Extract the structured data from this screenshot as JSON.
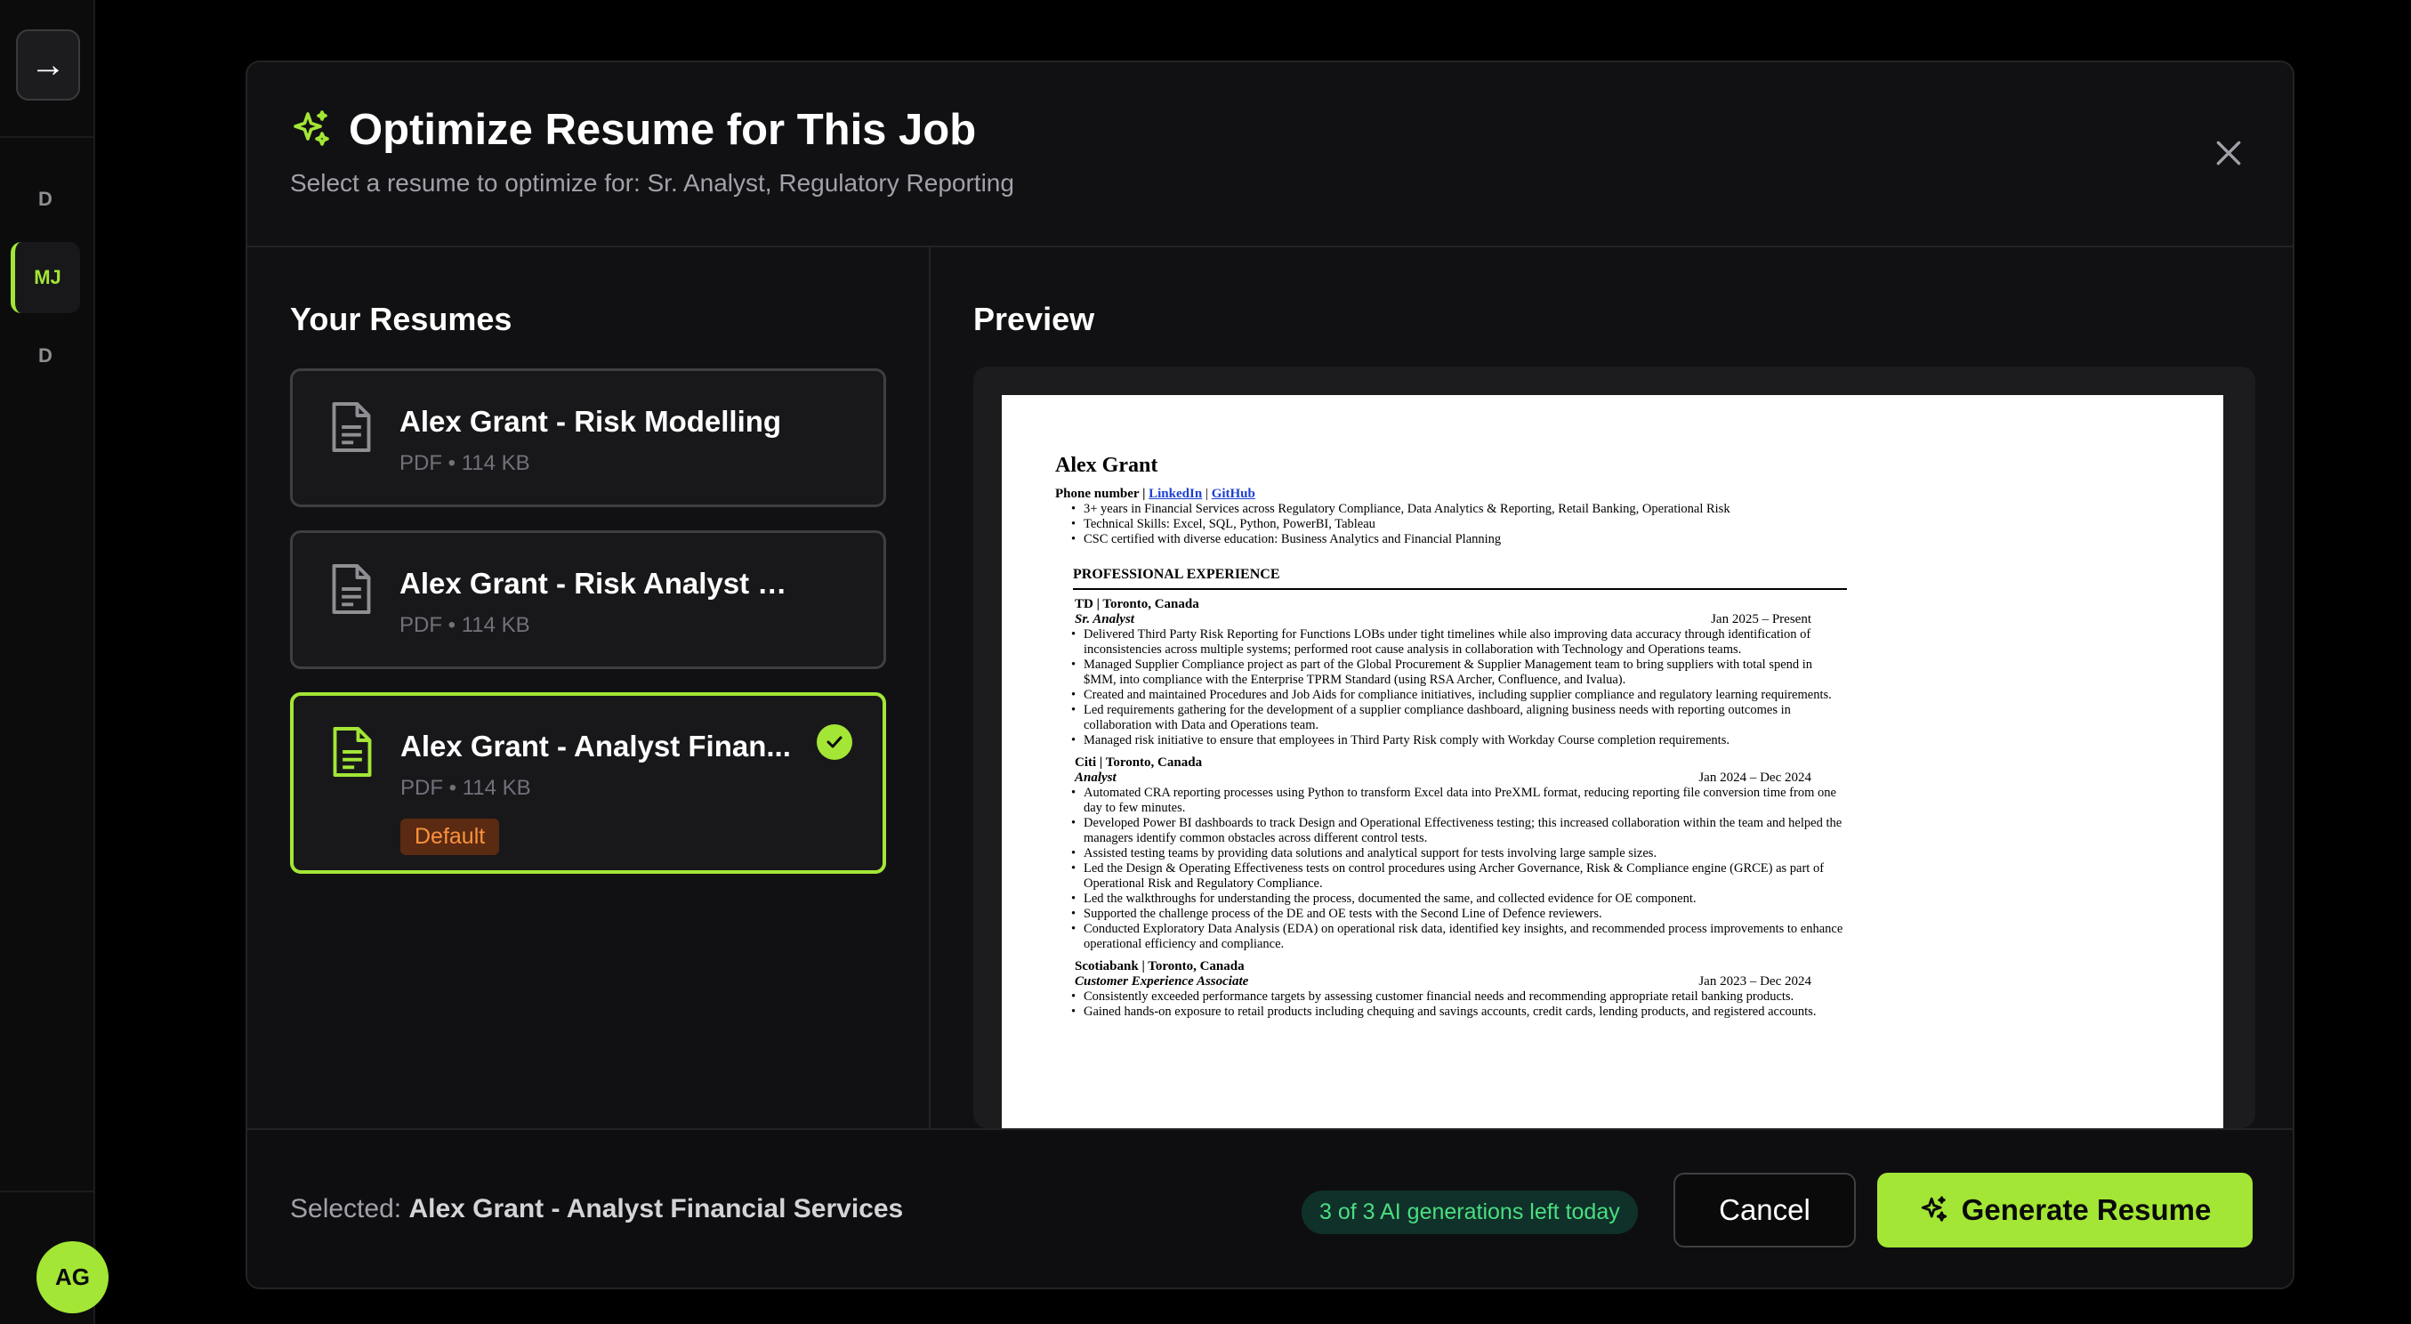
{
  "sidebar": {
    "toggle_icon": "→",
    "items": [
      {
        "label": "D"
      },
      {
        "label": "MJ"
      },
      {
        "label": "D"
      }
    ],
    "avatar": "AG"
  },
  "modal": {
    "title": "Optimize Resume for This Job",
    "subtitle": "Select a resume to optimize for: Sr. Analyst, Regulatory Reporting",
    "left_heading": "Your Resumes",
    "right_heading": "Preview",
    "resumes": [
      {
        "name": "Alex Grant - Risk Modelling",
        "meta": "PDF • 114 KB"
      },
      {
        "name": "Alex Grant - Risk Analyst Insur...",
        "meta": "PDF • 114 KB"
      },
      {
        "name": "Alex Grant - Analyst Finan...",
        "meta": "PDF • 114 KB",
        "badge": "Default"
      }
    ]
  },
  "preview": {
    "name": "Alex Grant",
    "contact_label": "Phone number |",
    "linkedin": "LinkedIn",
    "github": "GitHub",
    "summary": [
      "3+ years in Financial Services across Regulatory Compliance, Data Analytics & Reporting, Retail Banking, Operational Risk",
      "Technical Skills: Excel, SQL, Python, PowerBI, Tableau",
      "CSC certified with diverse education: Business Analytics and Financial Planning"
    ],
    "section": "PROFESSIONAL EXPERIENCE",
    "jobs": [
      {
        "company": "TD | Toronto, Canada",
        "role": "Sr. Analyst",
        "dates": "Jan 2025 – Present",
        "bullets": [
          "Delivered Third Party Risk Reporting for Functions LOBs under tight timelines while also improving data accuracy through identification of inconsistencies across multiple systems; performed root cause analysis in collaboration with Technology and Operations teams.",
          "Managed Supplier Compliance project as part of the Global Procurement & Supplier Management team to bring suppliers with total spend in $MM, into compliance with the Enterprise TPRM Standard (using RSA Archer, Confluence, and Ivalua).",
          "Created and maintained Procedures and Job Aids for compliance initiatives, including supplier compliance and regulatory learning requirements.",
          "Led requirements gathering for the development of a supplier compliance dashboard, aligning business needs with reporting outcomes in collaboration with Data and Operations team.",
          "Managed risk initiative to ensure that employees in Third Party Risk comply with Workday Course completion requirements."
        ]
      },
      {
        "company": "Citi | Toronto, Canada",
        "role": "Analyst",
        "dates": "Jan 2024 – Dec 2024",
        "bullets": [
          "Automated CRA reporting processes using Python to transform Excel data into PreXML format, reducing reporting file conversion time from one day to few minutes.",
          "Developed Power BI dashboards to track Design and Operational Effectiveness testing; this increased collaboration within the team and helped the managers identify common obstacles across different control tests.",
          "Assisted testing teams by providing data solutions and analytical support for tests involving large sample sizes.",
          "Led the Design & Operating Effectiveness tests on control procedures using Archer Governance, Risk & Compliance engine (GRCE) as part of Operational Risk and Regulatory Compliance.",
          "Led the walkthroughs for understanding the process, documented the same, and collected evidence for OE component.",
          "Supported the challenge process of the DE and OE tests with the Second Line of Defence reviewers.",
          "Conducted Exploratory Data Analysis (EDA) on operational risk data, identified key insights, and recommended process improvements to enhance operational efficiency and compliance."
        ]
      },
      {
        "company": "Scotiabank | Toronto, Canada",
        "role": "Customer Experience Associate",
        "dates": "Jan 2023 – Dec 2024",
        "bullets": [
          "Consistently exceeded performance targets by assessing customer financial needs and recommending appropriate retail banking products.",
          "Gained hands-on exposure to retail products including chequing and savings accounts, credit cards, lending products, and registered accounts."
        ]
      }
    ]
  },
  "footer": {
    "selected_label": "Selected:",
    "selected_value": "Alex Grant - Analyst Financial Services",
    "generations": "3 of 3 AI generations left today",
    "cancel": "Cancel",
    "generate": "Generate Resume"
  },
  "colors": {
    "accent": "#a3e635",
    "badge_bg": "#5a2a12",
    "badge_fg": "#fb923c",
    "pill_fg": "#4ade80"
  }
}
